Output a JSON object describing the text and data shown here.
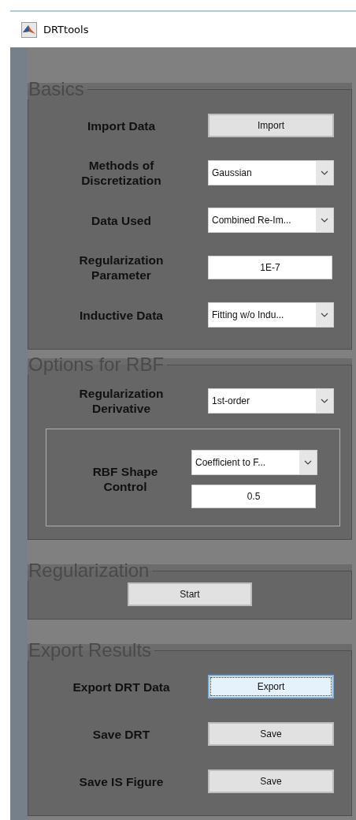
{
  "window": {
    "title": "DRTtools"
  },
  "sections": [
    {
      "title": "Basics",
      "rows": [
        {
          "kind": "row",
          "label": "Import Data",
          "controls": [
            {
              "kind": "button",
              "value": "Import",
              "focused": false
            }
          ]
        },
        {
          "kind": "row",
          "label": "Methods of Discretization",
          "controls": [
            {
              "kind": "dropdown",
              "value": "Gaussian"
            }
          ]
        },
        {
          "kind": "row",
          "label": "Data Used",
          "controls": [
            {
              "kind": "dropdown",
              "value": "Combined Re-Im..."
            }
          ]
        },
        {
          "kind": "row",
          "label": "Regularization Parameter",
          "controls": [
            {
              "kind": "input",
              "value": "1E-7"
            }
          ]
        },
        {
          "kind": "row",
          "label": "Inductive Data",
          "controls": [
            {
              "kind": "dropdown",
              "value": "Fitting w/o Indu..."
            }
          ]
        }
      ]
    },
    {
      "title": "Options for RBF",
      "rows": [
        {
          "kind": "row",
          "label": "Regularization Derivative",
          "controls": [
            {
              "kind": "dropdown",
              "value": "1st-order"
            }
          ]
        },
        {
          "kind": "subpanel",
          "label": "RBF Shape Control",
          "controls": [
            {
              "kind": "dropdown",
              "value": "Coefficient to F..."
            },
            {
              "kind": "input",
              "value": "0.5"
            }
          ]
        }
      ]
    },
    {
      "title": "Regularization",
      "rows": [
        {
          "kind": "center",
          "controls": [
            {
              "kind": "button",
              "value": "Start",
              "focused": false
            }
          ]
        }
      ]
    },
    {
      "title": "Export Results",
      "rows": [
        {
          "kind": "row",
          "label": "Export DRT Data",
          "controls": [
            {
              "kind": "button",
              "value": "Export",
              "focused": true
            }
          ]
        },
        {
          "kind": "row",
          "label": "Save DRT",
          "controls": [
            {
              "kind": "button",
              "value": "Save",
              "focused": false
            }
          ]
        },
        {
          "kind": "row",
          "label": "Save IS Figure",
          "controls": [
            {
              "kind": "button",
              "value": "Save",
              "focused": false
            }
          ]
        }
      ]
    }
  ]
}
